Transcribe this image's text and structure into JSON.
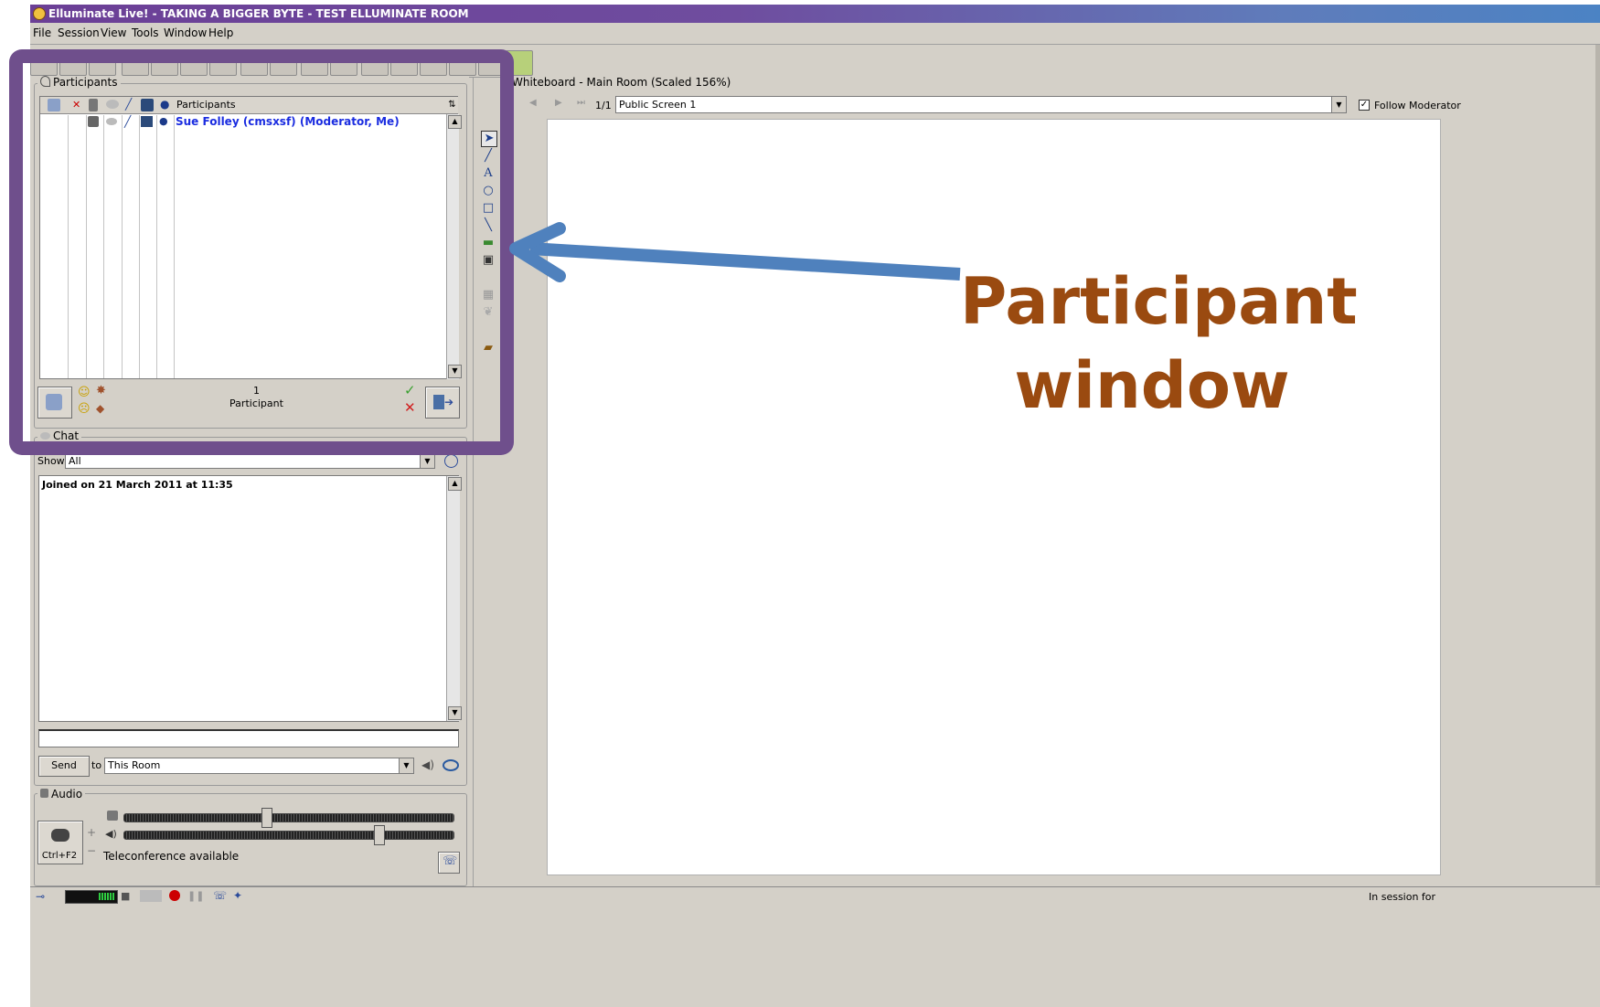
{
  "window": {
    "title": "Elluminate Live! - TAKING A BIGGER BYTE - TEST ELLUMINATE ROOM"
  },
  "menu": [
    "File",
    "Session",
    "View",
    "Tools",
    "Window",
    "Help"
  ],
  "participants_panel": {
    "label": "Participants",
    "column_header": "Participants",
    "rows": [
      {
        "name": "Sue Folley (cmsxsf) (Moderator, Me)"
      }
    ],
    "count": "1",
    "count_label": "Participant"
  },
  "chat_panel": {
    "label": "Chat",
    "show_label": "Show",
    "show_value": "All",
    "messages": [
      "Joined on 21 March 2011 at 11:35"
    ],
    "send_label": "Send",
    "to_label": "to",
    "to_value": "This Room"
  },
  "audio_panel": {
    "label": "Audio",
    "talk_button_label": "Ctrl+F2",
    "plus": "+",
    "minus": "−",
    "status": "Teleconference available",
    "mic_level": 0.42,
    "speaker_level": 0.76
  },
  "whiteboard": {
    "label": "Whiteboard - Main Room (Scaled 156%)",
    "page_indicator": "1/1",
    "screen_value": "Public Screen 1",
    "follow_label": "Follow Moderator",
    "follow_checked": true
  },
  "statusbar": {
    "session_text": "In session for"
  },
  "annotation": {
    "line1": "Participant",
    "line2": "window",
    "frame_color": "#6f4f8c",
    "arrow_color": "#4f81bd",
    "text_color": "#9a4a10"
  },
  "icons": [
    "hand-raise-icon",
    "mic-icon",
    "chat-icon",
    "pen-icon",
    "screen-icon",
    "user-icon",
    "smiley-icon",
    "check-icon",
    "cross-icon",
    "exit-icon",
    "pointer-icon",
    "text-icon",
    "circle-icon",
    "rectangle-icon",
    "line-icon",
    "image-icon",
    "camera-icon",
    "folder-icon",
    "speaker-icon",
    "eye-icon",
    "clock-icon"
  ]
}
